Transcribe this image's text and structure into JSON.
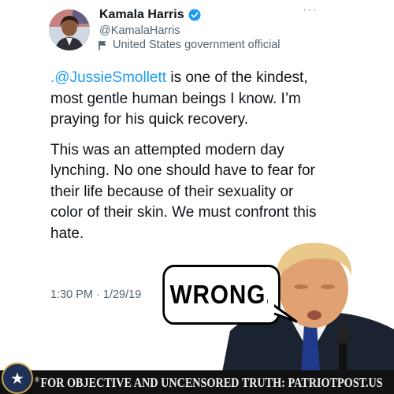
{
  "tweet": {
    "author": {
      "name": "Kamala Harris",
      "handle": "@KamalaHarris",
      "label": "United States government official",
      "verified": true
    },
    "more_icon": "more-options-icon",
    "paragraph1": {
      "mention": ".@JussieSmollett",
      "text": " is one of the kindest, most gentle human beings I know. I’m praying for his quick recovery."
    },
    "paragraph2": "This was an attempted modern day lynching. No one should have to fear for their life because of their sexuality or color of their skin. We must confront this hate.",
    "timestamp": "1:30 PM · 1/29/19"
  },
  "overlay": {
    "speech_bubble": "WRONG."
  },
  "footer": {
    "registered": "®",
    "text": "FOR OBJECTIVE AND UNCENSORED TRUTH: PATRIOTPOST.US"
  },
  "colors": {
    "mention": "#1d9bf0",
    "verified": "#1d9bf0",
    "secondary_text": "#536471",
    "footer_bg": "#111111"
  }
}
